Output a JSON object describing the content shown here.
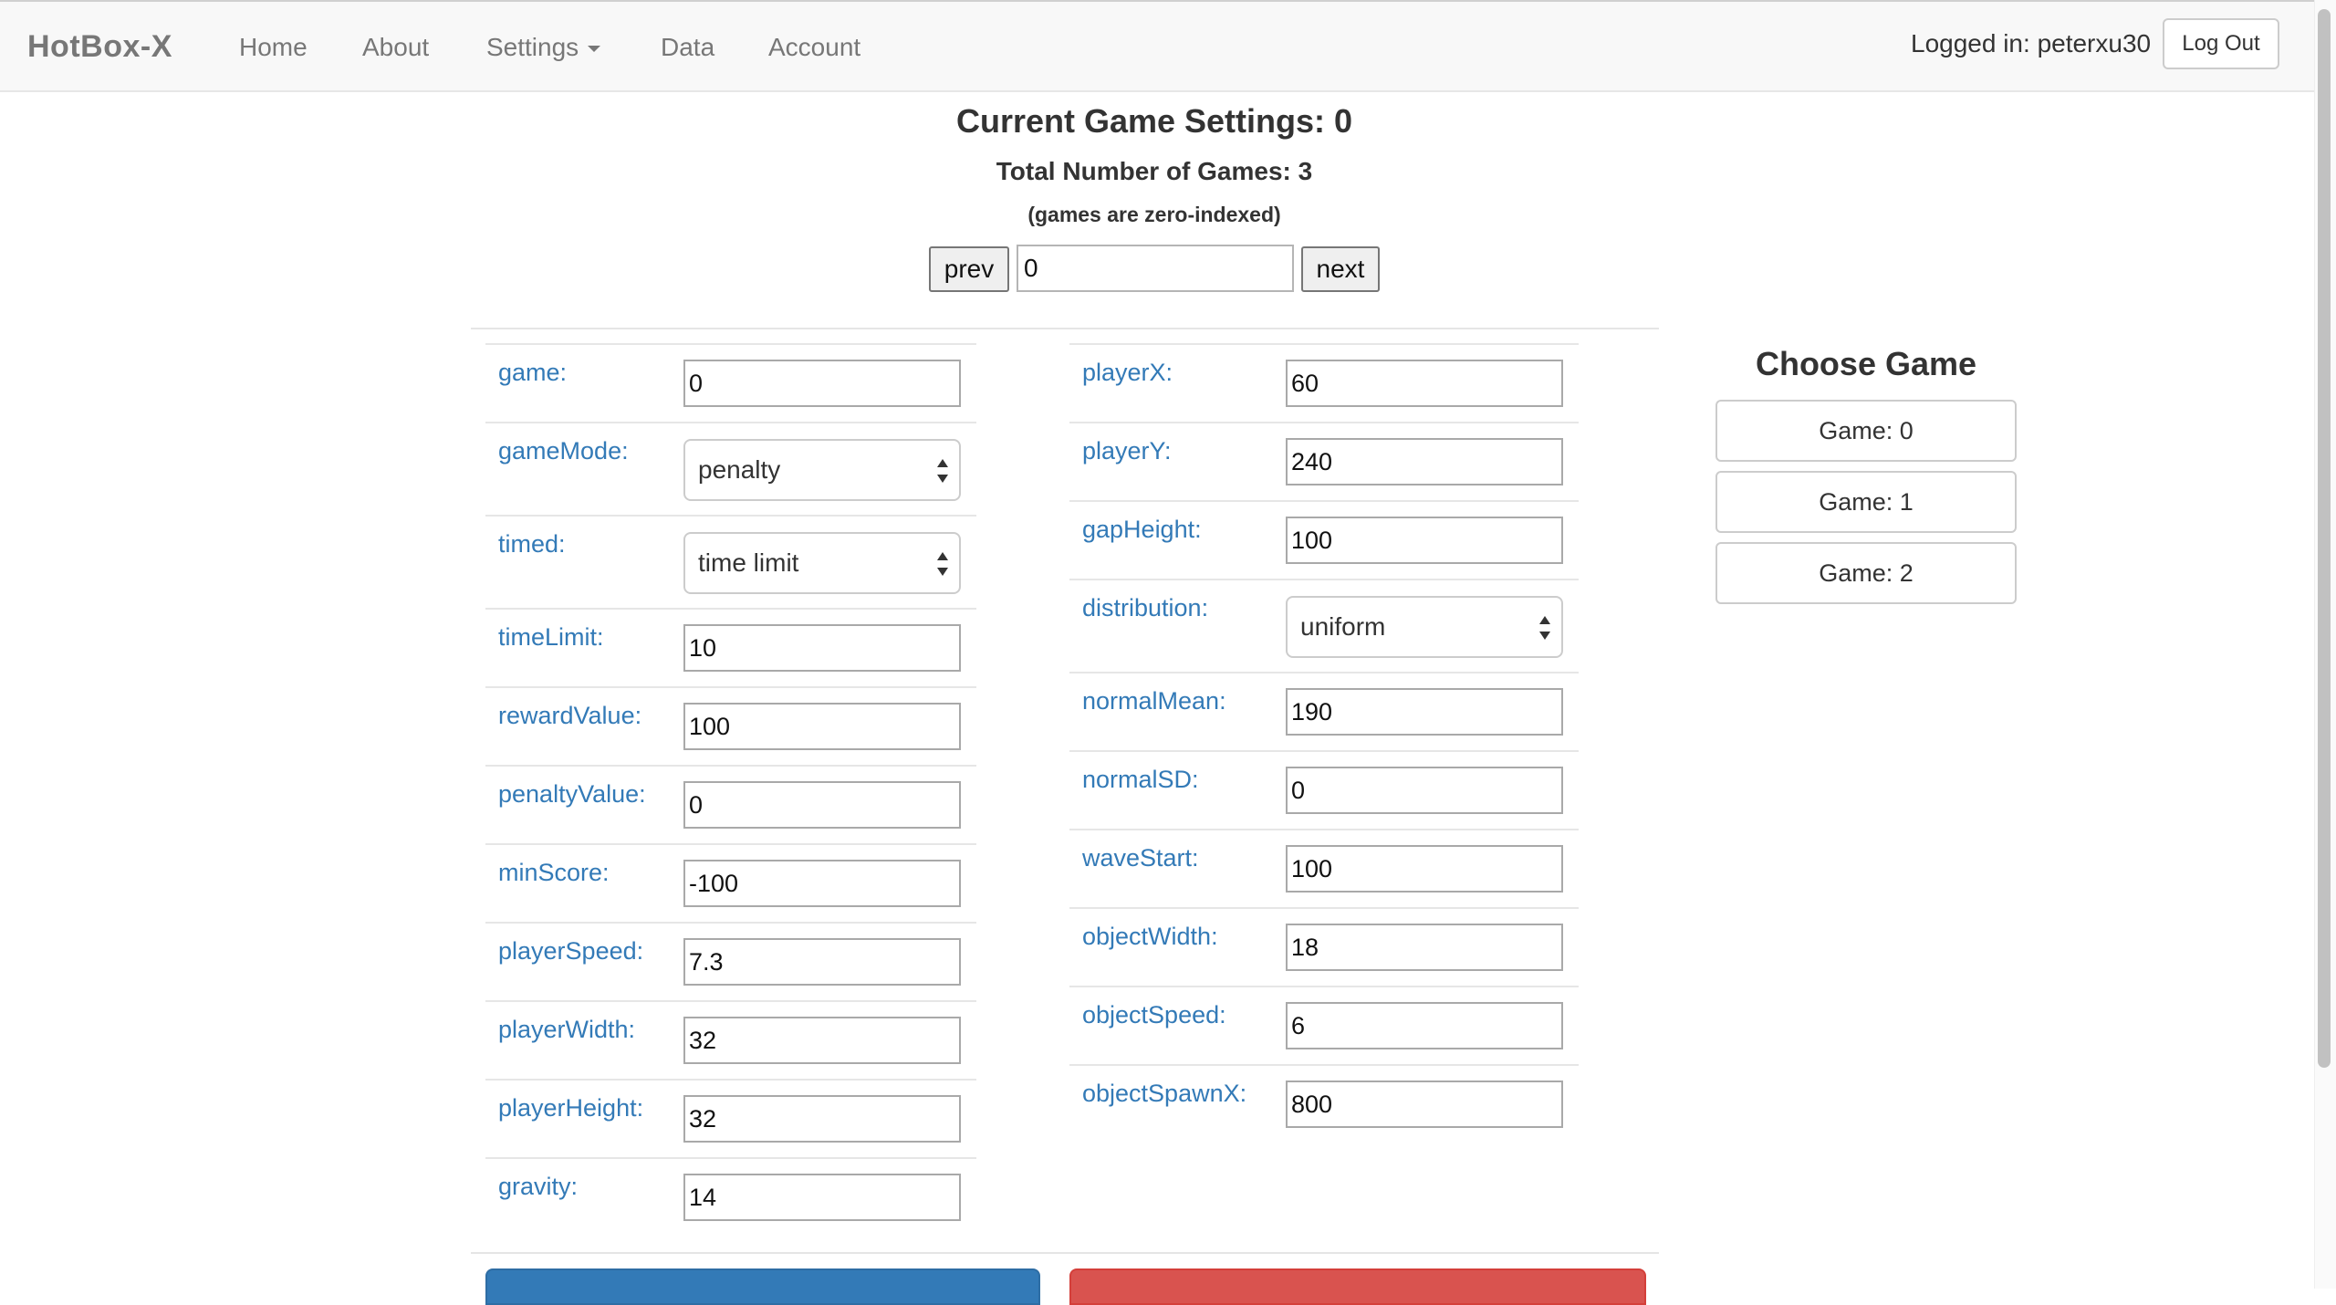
{
  "navbar": {
    "brand": "HotBox-X",
    "links": [
      "Home",
      "About",
      "Settings",
      "Data",
      "Account"
    ],
    "login_text": "Logged in: peterxu30",
    "logout_label": "Log Out"
  },
  "header": {
    "title": "Current Game Settings: 0",
    "total_games": "Total Number of Games: 3",
    "note": "(games are zero-indexed)",
    "prev_label": "prev",
    "next_label": "next",
    "game_index_value": "0"
  },
  "left_fields": [
    {
      "label": "game:",
      "type": "text",
      "value": "0"
    },
    {
      "label": "gameMode:",
      "type": "select",
      "value": "penalty"
    },
    {
      "label": "timed:",
      "type": "select",
      "value": "time limit"
    },
    {
      "label": "timeLimit:",
      "type": "text",
      "value": "10"
    },
    {
      "label": "rewardValue:",
      "type": "text",
      "value": "100"
    },
    {
      "label": "penaltyValue:",
      "type": "text",
      "value": "0"
    },
    {
      "label": "minScore:",
      "type": "text",
      "value": "-100"
    },
    {
      "label": "playerSpeed:",
      "type": "text",
      "value": "7.3"
    },
    {
      "label": "playerWidth:",
      "type": "text",
      "value": "32"
    },
    {
      "label": "playerHeight:",
      "type": "text",
      "value": "32"
    },
    {
      "label": "gravity:",
      "type": "text",
      "value": "14"
    }
  ],
  "right_fields": [
    {
      "label": "playerX:",
      "type": "text",
      "value": "60"
    },
    {
      "label": "playerY:",
      "type": "text",
      "value": "240"
    },
    {
      "label": "gapHeight:",
      "type": "text",
      "value": "100"
    },
    {
      "label": "distribution:",
      "type": "select",
      "value": "uniform"
    },
    {
      "label": "normalMean:",
      "type": "text",
      "value": "190"
    },
    {
      "label": "normalSD:",
      "type": "text",
      "value": "0"
    },
    {
      "label": "waveStart:",
      "type": "text",
      "value": "100"
    },
    {
      "label": "objectWidth:",
      "type": "text",
      "value": "18"
    },
    {
      "label": "objectSpeed:",
      "type": "text",
      "value": "6"
    },
    {
      "label": "objectSpawnX:",
      "type": "text",
      "value": "800"
    }
  ],
  "choose_game": {
    "title": "Choose Game",
    "games": [
      "Game: 0",
      "Game: 1",
      "Game: 2"
    ]
  },
  "colors": {
    "label_blue": "#337ab7",
    "primary": "#337ab7",
    "danger": "#d9534f"
  }
}
